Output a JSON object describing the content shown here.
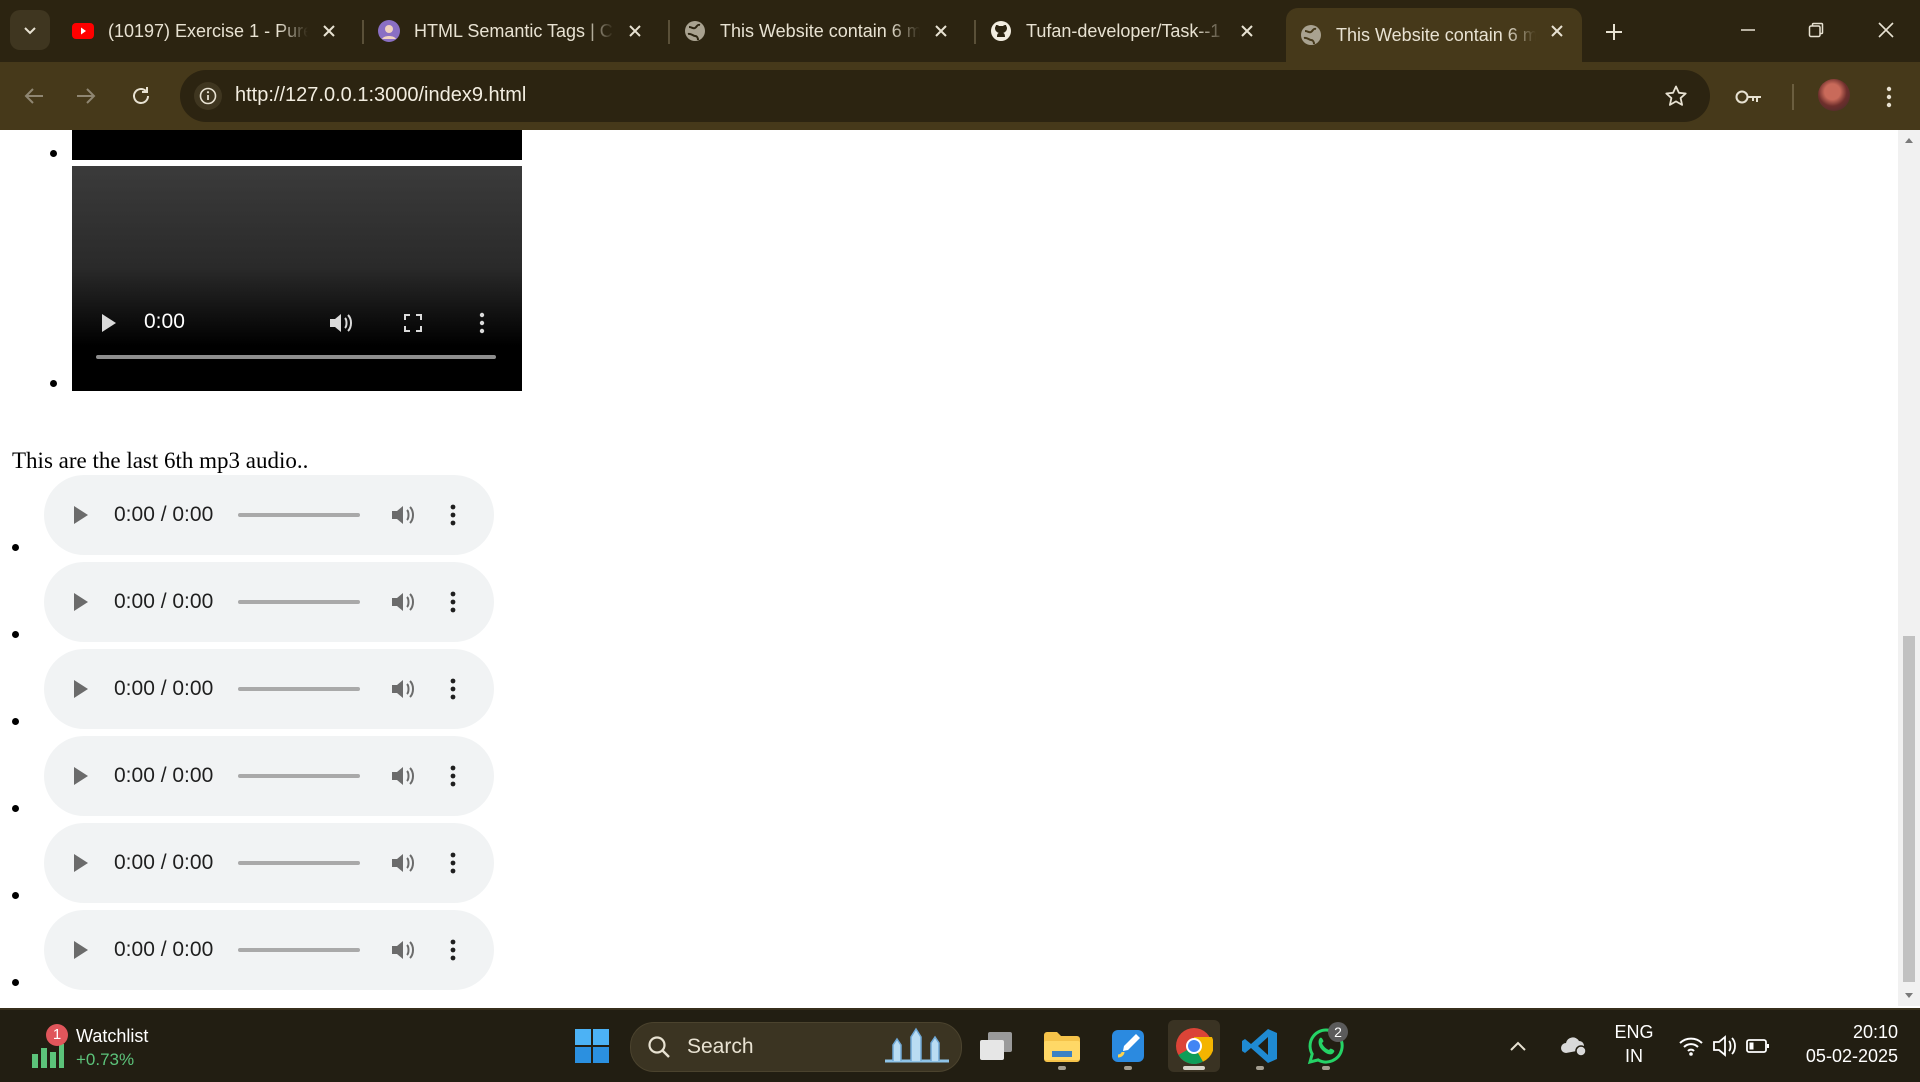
{
  "browser": {
    "tabs": [
      {
        "title": "(10197) Exercise 1 - Pure",
        "favicon": "youtube-icon"
      },
      {
        "title": "HTML Semantic Tags | Co",
        "favicon": "avatar-icon"
      },
      {
        "title": "This Website contain 6 m",
        "favicon": "globe-icon"
      },
      {
        "title": "Tufan-developer/Task--1",
        "favicon": "github-icon"
      },
      {
        "title": "This Website contain 6 m",
        "favicon": "globe-icon",
        "active": true
      }
    ],
    "url": "http://127.0.0.1:3000/index9.html"
  },
  "page": {
    "video": {
      "time": "0:00"
    },
    "audio_heading": "This are the last 6th mp3 audio..",
    "audios": [
      {
        "time": "0:00 / 0:00"
      },
      {
        "time": "0:00 / 0:00"
      },
      {
        "time": "0:00 / 0:00"
      },
      {
        "time": "0:00 / 0:00"
      },
      {
        "time": "0:00 / 0:00"
      },
      {
        "time": "0:00 / 0:00"
      }
    ]
  },
  "taskbar": {
    "widget": {
      "badge": "1",
      "title": "Watchlist",
      "change": "+0.73%"
    },
    "search_label": "Search",
    "whatsapp_badge": "2",
    "language": {
      "line1": "ENG",
      "line2": "IN"
    },
    "time": "20:10",
    "date": "05-02-2025"
  },
  "colors": {
    "chrome_dark": "#2c2411",
    "chrome_toolbar": "#46391a",
    "audio_bg": "#f1f3f4",
    "positive": "#5cc37a"
  }
}
